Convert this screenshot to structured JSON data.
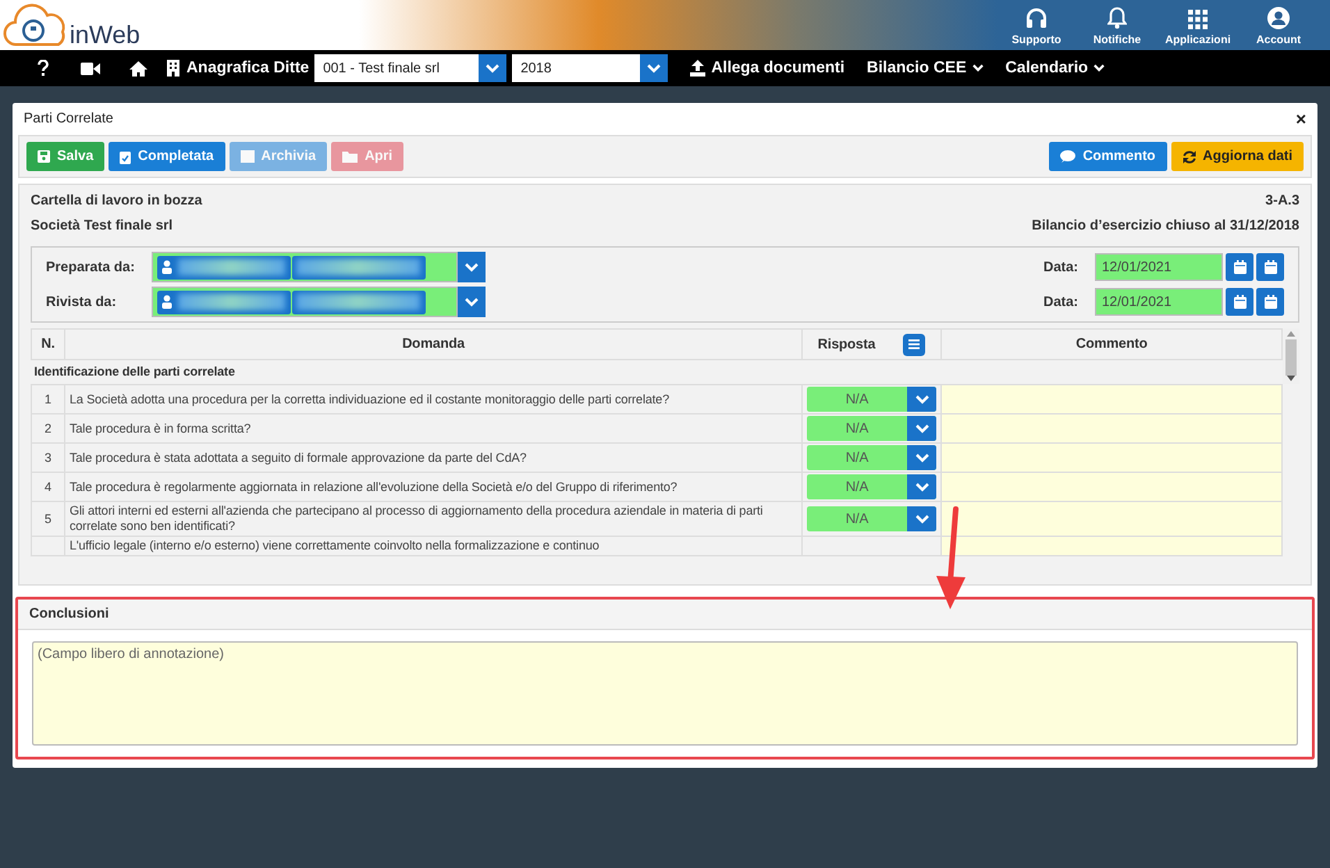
{
  "header": {
    "brand": "inWeb",
    "actions": [
      {
        "label": "Supporto"
      },
      {
        "label": "Notifiche"
      },
      {
        "label": "Applicazioni"
      },
      {
        "label": "Account"
      }
    ]
  },
  "nav": {
    "company_label": "Anagrafica Ditte",
    "company_select": "001 - Test finale srl",
    "year_select": "2018",
    "upload": "Allega documenti",
    "menus": [
      "Bilancio CEE",
      "Calendario"
    ]
  },
  "dialog": {
    "title": "Parti Correlate",
    "close": "×",
    "toolbar_left": [
      {
        "label": "Salva",
        "kind": "success",
        "disabled": false
      },
      {
        "label": "Completata",
        "kind": "primary",
        "disabled": false
      },
      {
        "label": "Archivia",
        "kind": "primary",
        "disabled": true
      },
      {
        "label": "Apri",
        "kind": "danger",
        "disabled": true
      }
    ],
    "toolbar_right": [
      {
        "label": "Commento",
        "kind": "primary",
        "disabled": false
      },
      {
        "label": "Aggiorna dati",
        "kind": "warning",
        "disabled": false
      }
    ],
    "info": {
      "status": "Cartella di lavoro in bozza",
      "code": "3-A.3",
      "company": "Società Test finale srl",
      "period": "Bilancio d’esercizio chiuso al 31/12/2018"
    },
    "signatures": [
      {
        "label": "Preparata da:",
        "date_label": "Data:",
        "date": "12/01/2021"
      },
      {
        "label": "Rivista da:",
        "date_label": "Data:",
        "date": "12/01/2021"
      }
    ],
    "table": {
      "columns": [
        "N.",
        "Domanda",
        "Risposta",
        "Commento"
      ],
      "section": "Identificazione delle parti correlate",
      "rows": [
        {
          "n": "1",
          "question": "La Società adotta una procedura per la corretta individuazione ed il costante monitoraggio delle parti correlate?",
          "answer": "N/A"
        },
        {
          "n": "2",
          "question": "Tale procedura è in forma scritta?",
          "answer": "N/A"
        },
        {
          "n": "3",
          "question": "Tale procedura è stata adottata a seguito di formale approvazione da parte del CdA?",
          "answer": "N/A"
        },
        {
          "n": "4",
          "question": "Tale procedura è regolarmente aggiornata in relazione all'evoluzione della Società e/o del Gruppo di riferimento?",
          "answer": "N/A"
        },
        {
          "n": "5",
          "question": "Gli attori interni ed esterni all'azienda che partecipano al processo di aggiornamento della procedura aziendale in materia di parti correlate sono ben identificati?",
          "answer": "N/A"
        },
        {
          "question": "L'ufficio legale (interno e/o esterno) viene correttamente coinvolto nella formalizzazione e continuo"
        }
      ]
    },
    "conclusions": {
      "title": "Conclusioni",
      "placeholder": "(Campo libero di annotazione)"
    }
  }
}
